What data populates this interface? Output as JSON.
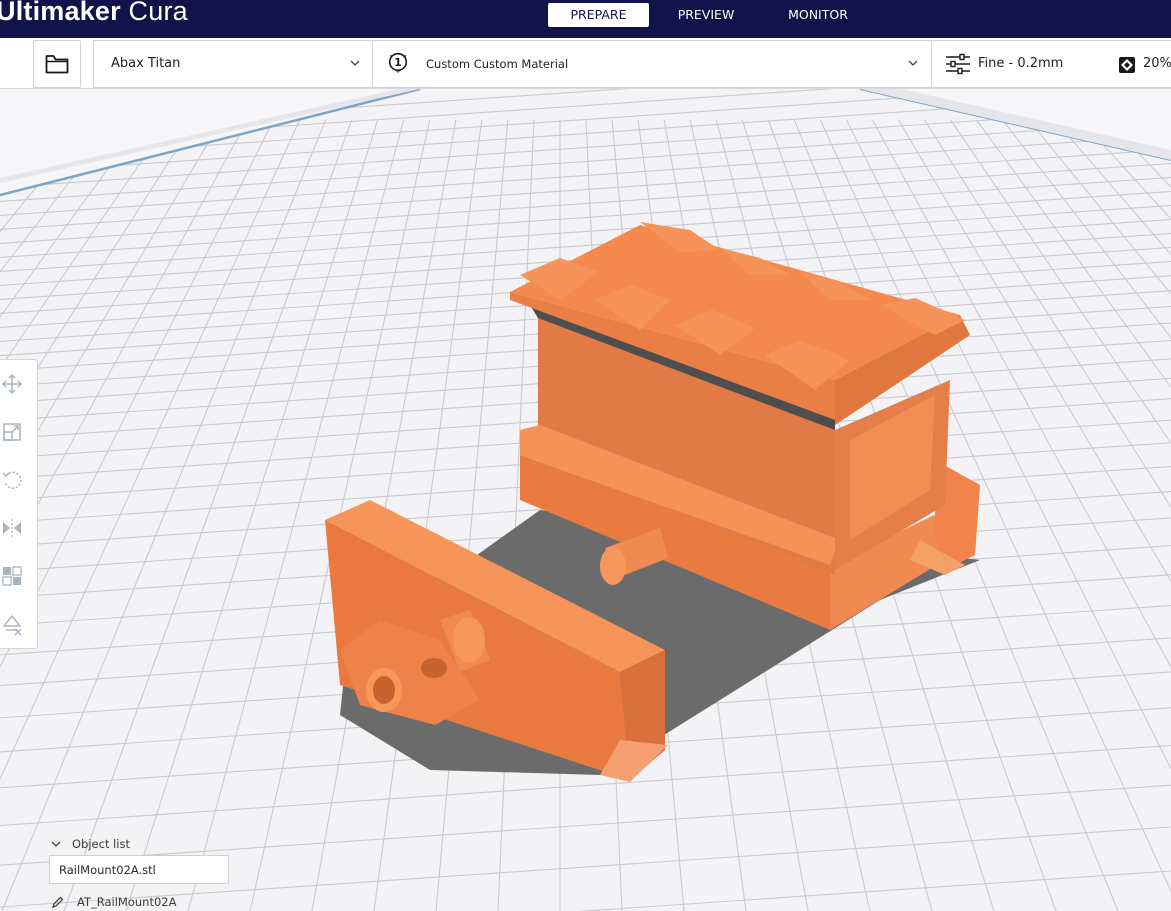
{
  "app": {
    "title_bold": "Ultimaker",
    "title_light": " Cura"
  },
  "stages": [
    {
      "label": "PREPARE",
      "active": true
    },
    {
      "label": "PREVIEW",
      "active": false
    },
    {
      "label": "MONITOR",
      "active": false
    }
  ],
  "toolbar": {
    "printer": "Abax Titan",
    "extruder_number": "1",
    "material": "Custom Custom Material",
    "print_profile": "Fine - 0.2mm",
    "infill": "20%"
  },
  "tools": [
    {
      "icon": "move-icon"
    },
    {
      "icon": "scale-icon"
    },
    {
      "icon": "rotate-icon"
    },
    {
      "icon": "mirror-icon"
    },
    {
      "icon": "per-model-settings-icon"
    },
    {
      "icon": "support-blocker-icon"
    }
  ],
  "object_list": {
    "header": "Object list",
    "items": [
      "RailMount02A.stl"
    ],
    "job_name": "AT_RailMount02A"
  },
  "colors": {
    "header_bg": "#10144a",
    "model": "#f0854a",
    "shadow": "#6b6b6b",
    "buildplate": "#f6f6f8",
    "grid": "#c9c9cf"
  }
}
